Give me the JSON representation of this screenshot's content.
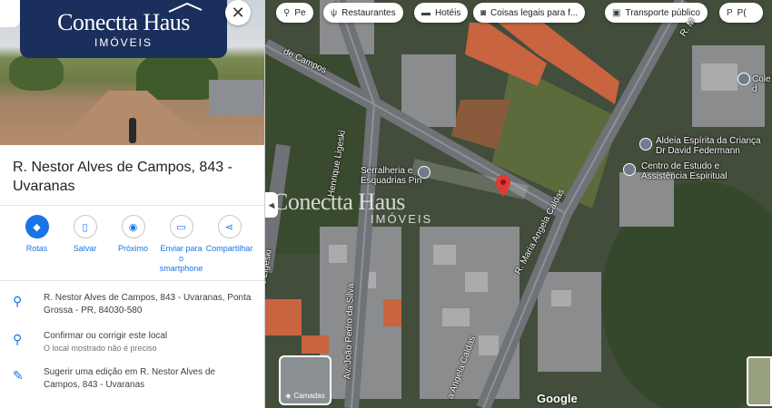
{
  "brand": {
    "name": "Conectta Haus",
    "tagline": "IMÓVEIS"
  },
  "place": {
    "title": "R. Nestor Alves de Campos, 843 - Uvaranas"
  },
  "actions": [
    {
      "label": "Rotas"
    },
    {
      "label": "Salvar"
    },
    {
      "label": "Próximo"
    },
    {
      "label": "Enviar para o smartphone"
    },
    {
      "label": "Compartilhar"
    }
  ],
  "info": {
    "address": "R. Nestor Alves de Campos, 843 - Uvaranas, Ponta Grossa - PR, 84030-580",
    "confirm": "Confirmar ou corrigir este local",
    "confirm_note": "O local mostrado não é preciso",
    "suggest": "Sugerir uma edição em R. Nestor Alves de Campos, 843 - Uvaranas"
  },
  "chips": [
    {
      "label": "Pe",
      "icon": "person-icon"
    },
    {
      "label": "Restaurantes",
      "icon": "restaurant-icon"
    },
    {
      "label": "Hotéis",
      "icon": "hotel-icon"
    },
    {
      "label": "Coisas legais para f...",
      "icon": "camera-icon"
    },
    {
      "label": "Transporte público",
      "icon": "transit-icon"
    },
    {
      "label": "P(",
      "icon": "parking-icon"
    }
  ],
  "map": {
    "streets": {
      "campos": "de Campos",
      "ligeski_vertical": "Henrique Ligeski",
      "ligeski_bottom": "ue Ligeski",
      "joao_pedro": "Av. João Pedro da Silva",
      "maria_angela": "R. Maria Angela Caldas",
      "angela_bottom": "a Angela Caldas",
      "top_right": "R. M"
    },
    "pois": {
      "serralheria": "Serralheria e Esquadrias Pin",
      "aldeia": "Aldeia Espírita da Criança Dr David Federmann",
      "centro": "Centro de Estudo e Assistência Espiritual",
      "colegio": "Cole d"
    },
    "layers_label": "Camadas",
    "attribution": "Google",
    "pin_color": "#e53935"
  }
}
